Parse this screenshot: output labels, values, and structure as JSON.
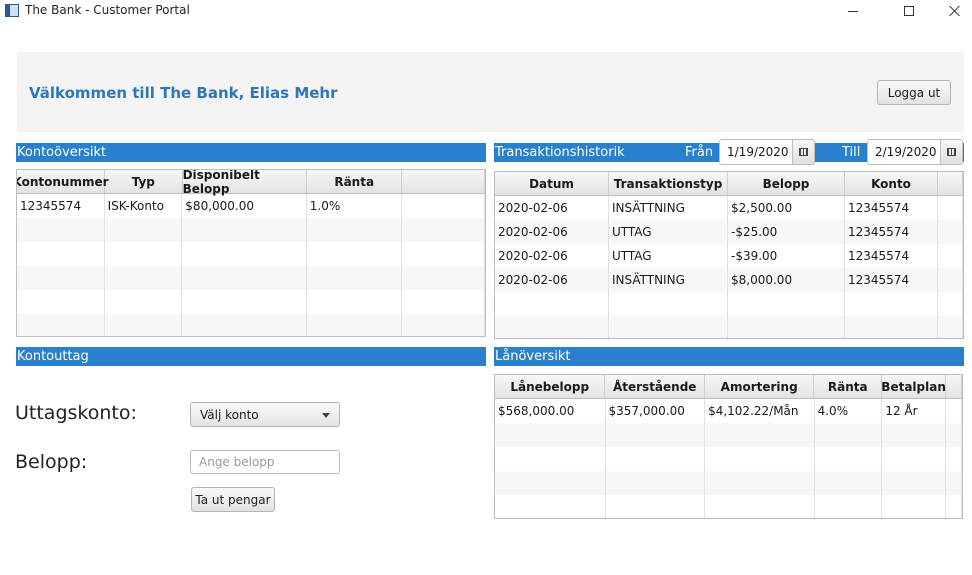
{
  "window": {
    "title": "The Bank - Customer Portal"
  },
  "header": {
    "welcome": "Välkommen till The Bank, Elias Mehr",
    "logout_label": "Logga ut"
  },
  "accounts": {
    "title": "Kontoöversikt",
    "columns": [
      "Kontonummer",
      "Typ",
      "Disponibelt Belopp",
      "Ränta"
    ],
    "rows": [
      [
        "12345574",
        "ISK-Konto",
        "$80,000.00",
        "1.0%"
      ]
    ]
  },
  "transactions": {
    "title": "Transaktionshistorik",
    "from_label": "Från",
    "from_date": "1/19/2020",
    "to_label": "Till",
    "to_date": "2/19/2020",
    "columns": [
      "Datum",
      "Transaktionstyp",
      "Belopp",
      "Konto"
    ],
    "rows": [
      [
        "2020-02-06",
        "INSÄTTNING",
        "$2,500.00",
        "12345574"
      ],
      [
        "2020-02-06",
        "UTTAG",
        "-$25.00",
        "12345574"
      ],
      [
        "2020-02-06",
        "UTTAG",
        "-$39.00",
        "12345574"
      ],
      [
        "2020-02-06",
        "INSÄTTNING",
        "$8,000.00",
        "12345574"
      ]
    ]
  },
  "withdrawal": {
    "title": "Kontouttag",
    "account_label": "Uttagskonto:",
    "account_select": "Välj konto",
    "amount_label": "Belopp:",
    "amount_placeholder": "Ange belopp",
    "amount_value": "",
    "submit_label": "Ta ut pengar"
  },
  "loans": {
    "title": "Lånöversikt",
    "columns": [
      "Lånebelopp",
      "Återstående",
      "Amortering",
      "Ränta",
      "Betalplan"
    ],
    "rows": [
      [
        "$568,000.00",
        "$357,000.00",
        "$4,102.22/Mån",
        "4.0%",
        "12 År"
      ]
    ]
  },
  "colors": {
    "accent": "#2980cc",
    "welcome_text": "#2d78bc",
    "header_bg": "#f4f4f4"
  }
}
